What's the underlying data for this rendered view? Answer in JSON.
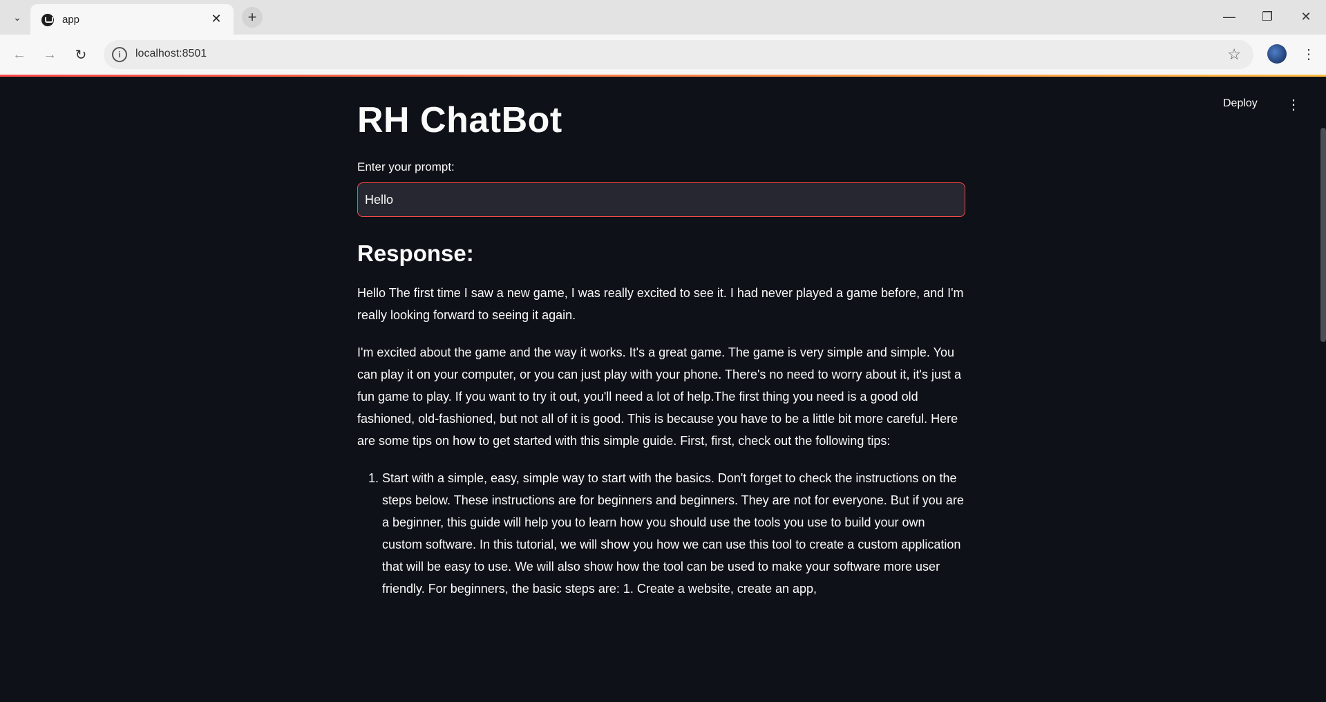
{
  "browser": {
    "tab_title": "app",
    "url": "localhost:8501"
  },
  "app": {
    "deploy_label": "Deploy",
    "title": "RH ChatBot",
    "prompt_label": "Enter your prompt:",
    "prompt_value": "Hello",
    "response_heading": "Response:",
    "paragraphs": [
      "Hello The first time I saw a new game, I was really excited to see it. I had never played a game before, and I'm really looking forward to seeing it again.",
      "I'm excited about the game and the way it works. It's a great game. The game is very simple and simple. You can play it on your computer, or you can just play with your phone. There's no need to worry about it, it's just a fun game to play. If you want to try it out, you'll need a lot of help.The first thing you need is a good old fashioned, old-fashioned, but not all of it is good. This is because you have to be a little bit more careful. Here are some tips on how to get started with this simple guide. First, first, check out the following tips:"
    ],
    "list_items": [
      "Start with a simple, easy, simple way to start with the basics. Don't forget to check the instructions on the steps below. These instructions are for beginners and beginners. They are not for everyone. But if you are a beginner, this guide will help you to learn how you should use the tools you use to build your own custom software. In this tutorial, we will show you how we can use this tool to create a custom application that will be easy to use. We will also show how the tool can be used to make your software more user friendly. For beginners, the basic steps are: 1. Create a website, create an app,"
    ]
  },
  "colors": {
    "background": "#0e1117",
    "accent": "#ff4b4b",
    "text": "#fafafa"
  }
}
